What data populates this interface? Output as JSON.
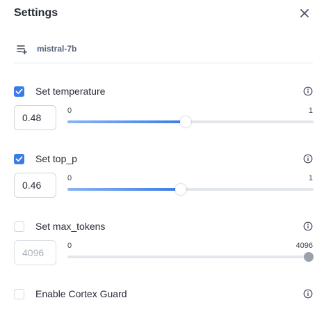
{
  "header": {
    "title": "Settings"
  },
  "model": {
    "name": "mistral-7b"
  },
  "settings": [
    {
      "label": "Set temperature",
      "checked": true,
      "value": "0.48",
      "min": "0",
      "max": "1",
      "fraction": 0.48
    },
    {
      "label": "Set top_p",
      "checked": true,
      "value": "0.46",
      "min": "0",
      "max": "1",
      "fraction": 0.46
    },
    {
      "label": "Set max_tokens",
      "checked": false,
      "value": "4096",
      "min": "0",
      "max": "4096",
      "fraction": 1.0
    },
    {
      "label": "Enable Cortex Guard",
      "checked": false
    }
  ],
  "colors": {
    "accent": "#3b7ce4",
    "track": "#e3e6eb"
  }
}
